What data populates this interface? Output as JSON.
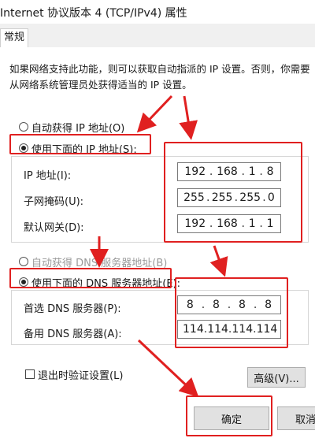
{
  "window": {
    "title": "Internet 协议版本 4 (TCP/IPv4) 属性"
  },
  "tabs": [
    {
      "label": "常规"
    }
  ],
  "description": "如果网络支持此功能，则可以获取自动指派的 IP 设置。否则，你需要从网络系统管理员处获得适当的 IP 设置。",
  "ip_section": {
    "auto_label": "自动获得 IP 地址(O)",
    "manual_label": "使用下面的 IP 地址(S):",
    "fields": [
      {
        "label": "IP 地址(I):",
        "value": [
          "192",
          "168",
          "1",
          "8"
        ]
      },
      {
        "label": "子网掩码(U):",
        "value": [
          "255",
          "255",
          "255",
          "0"
        ]
      },
      {
        "label": "默认网关(D):",
        "value": [
          "192",
          "168",
          "1",
          "1"
        ]
      }
    ]
  },
  "dns_section": {
    "auto_label": "自动获得 DNS 服务器地址(B)",
    "manual_label": "使用下面的 DNS 服务器地址(E):",
    "fields": [
      {
        "label": "首选 DNS 服务器(P):",
        "value": [
          "8",
          "8",
          "8",
          "8"
        ]
      },
      {
        "label": "备用 DNS 服务器(A):",
        "value": [
          "114",
          "114",
          "114",
          "114"
        ]
      }
    ]
  },
  "validate_checkbox_label": "退出时验证设置(L)",
  "advanced_button": "高级(V)...",
  "ok_button": "确定",
  "cancel_button": "取消",
  "colors": {
    "highlight": "#e02020",
    "button": "#e1e1e1"
  }
}
